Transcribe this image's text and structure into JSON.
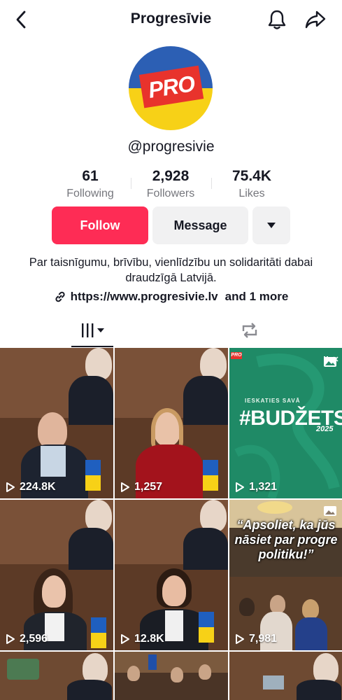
{
  "header": {
    "title": "Progresīvie",
    "back_icon": "chevron-left-icon",
    "bell_icon": "bell-icon",
    "share_icon": "share-arrow-icon"
  },
  "profile": {
    "avatar_text": "PRO",
    "handle": "@progresivie",
    "stats": [
      {
        "value": "61",
        "label": "Following"
      },
      {
        "value": "2,928",
        "label": "Followers"
      },
      {
        "value": "75.4K",
        "label": "Likes"
      }
    ],
    "bio": "Par taisnīgumu, brīvību, vienlīdzību un solidaritāti dabai draudzīgā Latvijā.",
    "link": "https://www.progresivie.lv",
    "link_more": "and 1 more"
  },
  "actions": {
    "follow_label": "Follow",
    "message_label": "Message"
  },
  "tabs": [
    {
      "name": "videos",
      "icon": "grid-icon",
      "active": true
    },
    {
      "name": "reposts",
      "icon": "repost-icon",
      "active": false
    }
  ],
  "videos": [
    {
      "views": "224.8K"
    },
    {
      "views": "1,257"
    },
    {
      "views": "1,321",
      "kicker": "IESKATIES SAVĀ",
      "title": "#BUDŽETS",
      "year": "2025",
      "badge": "PRO"
    },
    {
      "views": "2,596"
    },
    {
      "views": "12.8K"
    },
    {
      "views": "7,981",
      "quote_lines": [
        "“Apsoliet, ka jūs",
        "nāsiet par progre",
        "politiku!”"
      ]
    },
    {
      "views": ""
    },
    {
      "views": ""
    },
    {
      "views": ""
    }
  ],
  "colors": {
    "follow": "#fe2c55",
    "avatar_blue": "#2c5fb4",
    "avatar_yellow": "#f7d117",
    "avatar_red": "#e8332c",
    "budget_green": "#1f8a66"
  }
}
